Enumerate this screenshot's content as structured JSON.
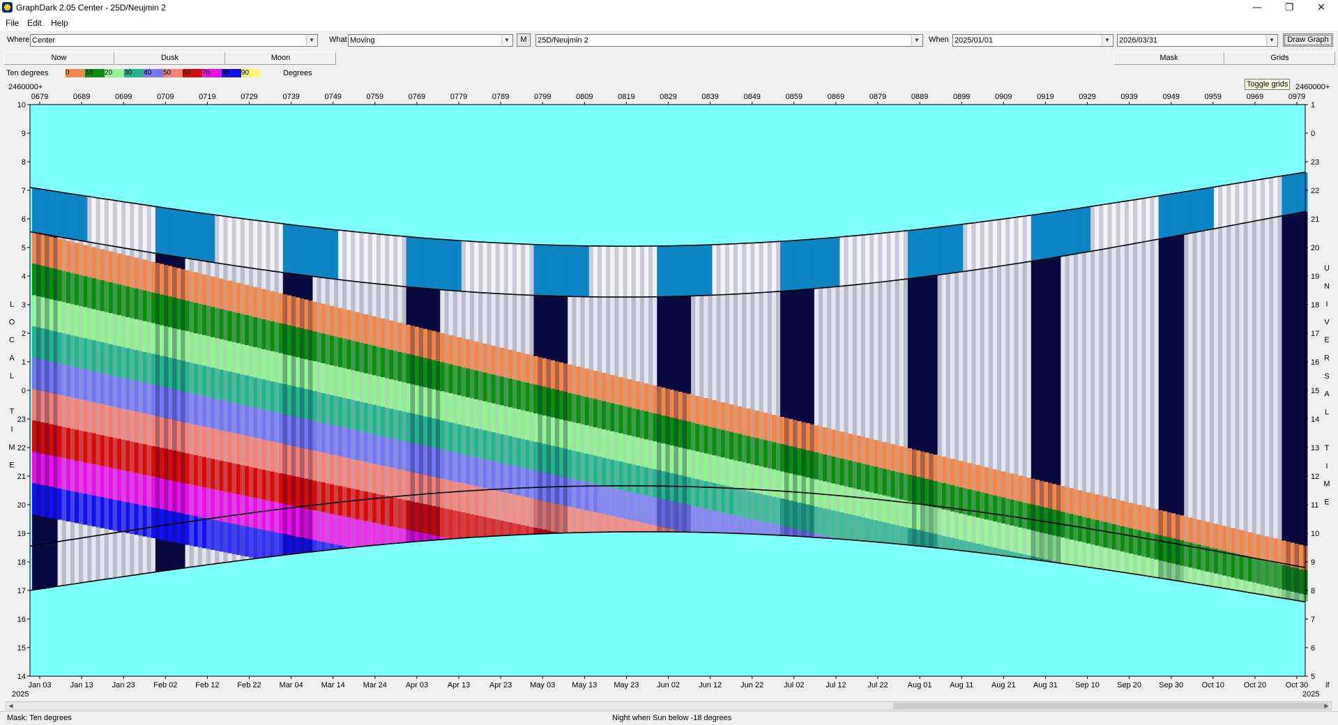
{
  "window": {
    "title": "GraphDark 2.05  Center  -  25D/Neujmin 2",
    "minimize_glyph": "—",
    "maximize_glyph": "❐",
    "close_glyph": "✕"
  },
  "menu": [
    "File",
    "Edit",
    "Help"
  ],
  "toolbar": {
    "where_label": "Where",
    "where_value": "Center",
    "what_label": "What",
    "what_value": "Moving",
    "m_button": "M",
    "object_value": "25D/Neujmin 2",
    "when_label": "When",
    "start_date": "2025/01/01",
    "end_date": "2026/03/31",
    "draw_button": "Draw Graph"
  },
  "buttons": {
    "now": "Now",
    "dusk": "Dusk",
    "moon": "Moon",
    "mask": "Mask",
    "grids": "Grids"
  },
  "tooltip": "Toggle grids",
  "legend": {
    "mode": "Ten degrees",
    "unit": "Degrees",
    "colors": [
      "#f0884c",
      "#0c8c10",
      "#93f493",
      "#25b48c",
      "#7478f2",
      "#f28278",
      "#d80a0a",
      "#ea10ea",
      "#1010f2",
      "#fff678"
    ],
    "labels": [
      "0",
      "10",
      "20",
      "30",
      "40",
      "50",
      "60",
      "70",
      "80",
      "90"
    ]
  },
  "graph": {
    "top_axis_prefix_left": "2460000+",
    "top_axis_prefix_right": "2460000+",
    "jd_labels": [
      "0679",
      "0689",
      "0699",
      "0709",
      "0719",
      "0729",
      "0739",
      "0749",
      "0759",
      "0769",
      "0779",
      "0789",
      "0799",
      "0809",
      "0819",
      "0829",
      "0839",
      "0849",
      "0859",
      "0869",
      "0879",
      "0889",
      "0899",
      "0909",
      "0919",
      "0929",
      "0939",
      "0949",
      "0959",
      "0969",
      "0979"
    ],
    "date_labels": [
      "Jan 03",
      "Jan 13",
      "Jan 23",
      "Feb 02",
      "Feb 12",
      "Feb 22",
      "Mar 04",
      "Mar 14",
      "Mar 24",
      "Apr 03",
      "Apr 13",
      "Apr 23",
      "May 03",
      "May 13",
      "May 23",
      "Jun 02",
      "Jun 12",
      "Jun 22",
      "Jul 02",
      "Jul 12",
      "Jul 22",
      "Aug 01",
      "Aug 11",
      "Aug 21",
      "Aug 31",
      "Sep 10",
      "Sep 20",
      "Sep 30",
      "Oct 10",
      "Oct 20",
      "Oct 30"
    ],
    "year_left": "2025",
    "year_right": "2025",
    "right_bottom_mark": "if",
    "left_ticks": [
      "10",
      "9",
      "8",
      "7",
      "6",
      "5",
      "4",
      "3",
      "2",
      "1",
      "0",
      "23",
      "22",
      "21",
      "20",
      "19",
      "18",
      "17",
      "16",
      "15",
      "14"
    ],
    "right_ticks": [
      "1",
      "0",
      "23",
      "22",
      "21",
      "20",
      "19",
      "18",
      "17",
      "16",
      "15",
      "14",
      "13",
      "12",
      "11",
      "10",
      "9",
      "8",
      "7",
      "6",
      "5"
    ],
    "left_title_letters": [
      "L",
      "O",
      "C",
      "A",
      "L",
      "",
      "T",
      "I",
      "M",
      "E"
    ],
    "right_title_letters": [
      "U",
      "N",
      "I",
      "V",
      "E",
      "R",
      "S",
      "A",
      "L",
      "",
      "T",
      "I",
      "M",
      "E"
    ]
  },
  "status": {
    "left": "Mask:  Ten degrees",
    "center": "Night when Sun below -18 degrees"
  }
}
